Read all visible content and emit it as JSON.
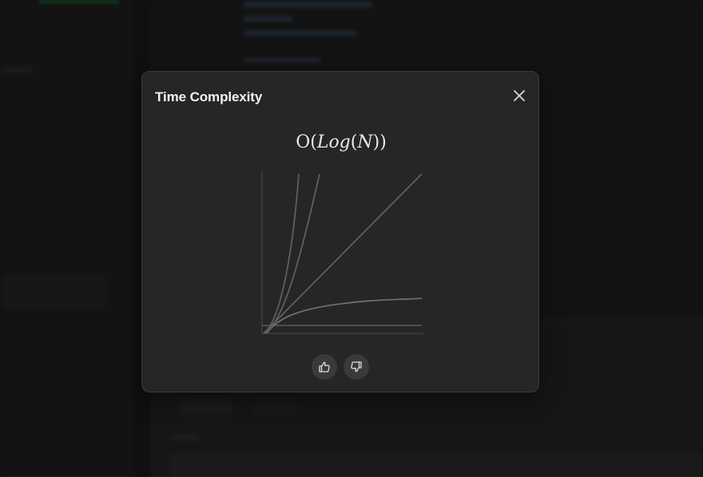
{
  "dialog": {
    "title": "Time Complexity",
    "complexity": {
      "prefix": "O(",
      "func": "Log",
      "arg_open": "(",
      "var": "N",
      "suffix": "))"
    }
  },
  "icons": {
    "close": "close-icon",
    "like": "thumbs-up-icon",
    "dislike": "thumbs-down-icon"
  },
  "chart_data": {
    "type": "line",
    "title": "",
    "xlabel": "",
    "ylabel": "",
    "grid": false,
    "x": [
      1,
      2,
      3,
      4,
      5,
      6,
      7,
      8,
      9,
      10
    ],
    "xlim": [
      0,
      10
    ],
    "ylim": [
      0,
      10
    ],
    "series": [
      {
        "function": "constant",
        "values": [
          0.5,
          0.5,
          0.5,
          0.5,
          0.5,
          0.5,
          0.5,
          0.5,
          0.5,
          0.5
        ],
        "highlight": false
      },
      {
        "function": "log",
        "values": [
          0.2,
          1.5,
          1.85,
          2.05,
          2.2,
          2.3,
          2.4,
          2.45,
          2.5,
          2.55
        ],
        "highlight": true
      },
      {
        "function": "linear",
        "values": [
          1,
          2,
          3,
          4,
          5,
          6,
          7,
          8,
          9,
          10
        ],
        "highlight": false
      },
      {
        "function": "n-log-n",
        "values": [
          0.8,
          4.4,
          10
        ],
        "highlight": false
      },
      {
        "function": "quadratic",
        "values": [
          1,
          10
        ],
        "highlight": false
      }
    ],
    "colors": {
      "axis": "#4a4a4a",
      "line": "#5f5f5f",
      "highlight": "#6e6e6e"
    }
  }
}
